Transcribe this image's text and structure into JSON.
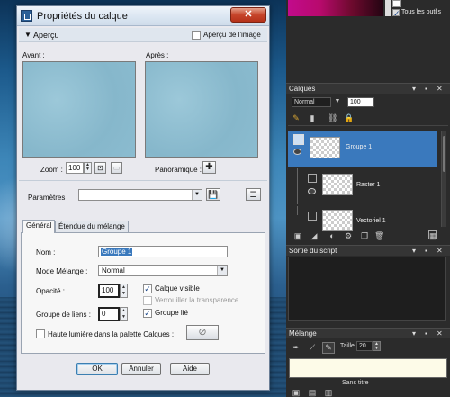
{
  "dialog": {
    "title": "Propriétés du calque",
    "close_glyph": "✕",
    "preview": {
      "section_label": "Aperçu",
      "on_image_label": "Aperçu de l'image",
      "before_label": "Avant :",
      "after_label": "Après :",
      "zoom_label": "Zoom :",
      "zoom_value": "100",
      "pan_label": "Panoramique :"
    },
    "params_label": "Paramètres",
    "tabs": [
      {
        "label": "Général"
      },
      {
        "label": "Étendue du mélange"
      }
    ],
    "general": {
      "name_label": "Nom :",
      "name_value": "Groupe 1",
      "blend_mode_label": "Mode Mélange :",
      "blend_mode_value": "Normal",
      "opacity_label": "Opacité :",
      "opacity_value": "100",
      "visible_label": "Calque visible",
      "lock_transparency_label": "Verrouiller la transparence",
      "link_group_label": "Groupe de liens :",
      "link_group_value": "0",
      "group_linked_label": "Groupe lié",
      "highlight_label": "Haute lumière dans la palette Calques :"
    },
    "buttons": {
      "ok": "OK",
      "cancel": "Annuler",
      "help": "Aide"
    }
  },
  "right_panels": {
    "top_checkbox_label": "Tous les outils",
    "layers": {
      "title": "Calques",
      "blend_mode": "Normal",
      "opacity": "100",
      "items": [
        {
          "name": "Groupe 1"
        },
        {
          "name": "Raster 1"
        },
        {
          "name": "Vectoriel 1"
        }
      ]
    },
    "script_output": {
      "title": "Sortie du script"
    },
    "mixer": {
      "title": "Mélange",
      "size_label": "Taille :",
      "size_value": "20",
      "bottom_label": "Sans titre"
    }
  },
  "colors": {
    "accent": "#3a79bd",
    "preview": "#8fbfd2",
    "dialog_bg": "#e9e9ee",
    "panel_bg": "#2b2b2b"
  }
}
